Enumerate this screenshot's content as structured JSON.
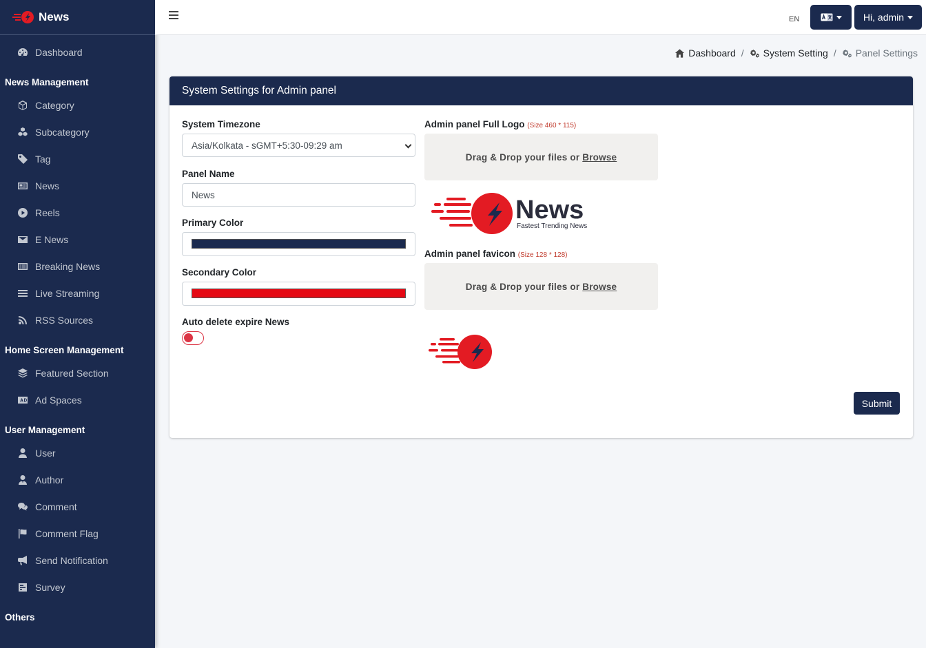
{
  "brand": {
    "name": "News"
  },
  "sidebar": {
    "dashboard": "Dashboard",
    "sections": [
      {
        "header": "News Management",
        "items": [
          "Category",
          "Subcategory",
          "Tag",
          "News",
          "Reels",
          "E News",
          "Breaking News",
          "Live Streaming",
          "RSS Sources"
        ]
      },
      {
        "header": "Home Screen Management",
        "items": [
          "Featured Section",
          "Ad Spaces"
        ]
      },
      {
        "header": "User Management",
        "items": [
          "User",
          "Author",
          "Comment",
          "Comment Flag",
          "Send Notification",
          "Survey"
        ]
      },
      {
        "header": "Others",
        "items": []
      }
    ]
  },
  "topbar": {
    "lang_code": "EN",
    "user_greeting": "Hi, admin"
  },
  "breadcrumb": {
    "home": "Dashboard",
    "parent": "System Setting",
    "current": "Panel Settings"
  },
  "card": {
    "title": "System Settings for Admin panel",
    "timezone": {
      "label": "System Timezone",
      "value": "Asia/Kolkata - sGMT+5:30-09:29 am"
    },
    "panel_name": {
      "label": "Panel Name",
      "value": "News"
    },
    "primary_color": {
      "label": "Primary Color",
      "value": "#1b2a4e"
    },
    "secondary_color": {
      "label": "Secondary Color",
      "value": "#e50914"
    },
    "auto_delete": {
      "label": "Auto delete expire News",
      "enabled": false
    },
    "full_logo": {
      "label": "Admin panel Full Logo",
      "size_hint": "(Size 460 * 115)"
    },
    "favicon": {
      "label": "Admin panel favicon",
      "size_hint": "(Size 128 * 128)"
    },
    "dropzone": {
      "text": "Drag & Drop your files or",
      "browse": "Browse"
    },
    "logo_preview": {
      "title": "News",
      "tagline": "Fastest Trending News"
    },
    "submit_label": "Submit"
  },
  "colors": {
    "navy": "#1b2a4e",
    "red": "#e31b23",
    "toggle_red": "#dc3545"
  }
}
